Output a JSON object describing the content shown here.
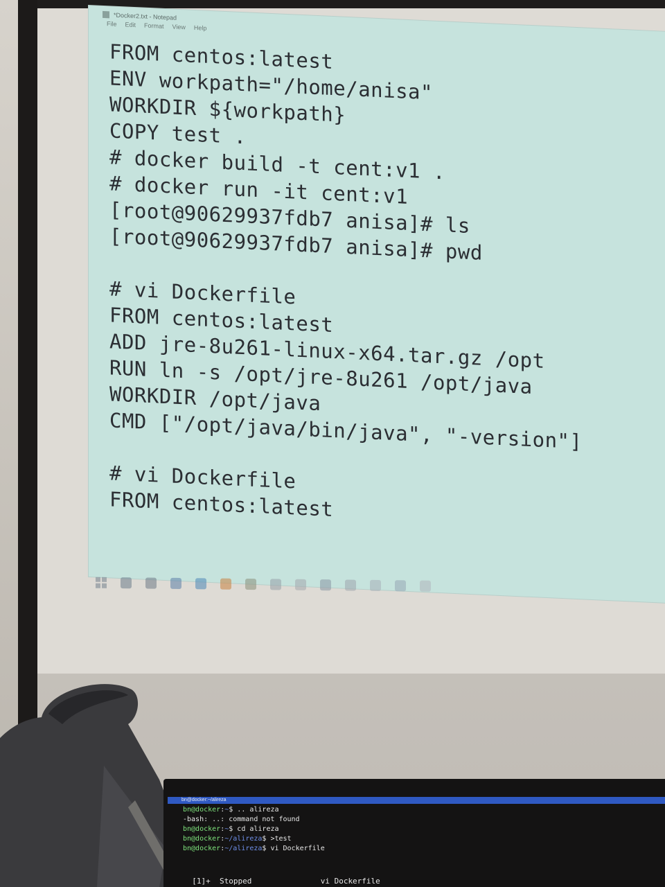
{
  "notepad": {
    "title": "*Docker2.txt - Notepad",
    "menu": [
      "File",
      "Edit",
      "Format",
      "View",
      "Help"
    ],
    "lines": [
      "FROM centos:latest",
      "ENV workpath=\"/home/anisa\"",
      "WORKDIR ${workpath}",
      "COPY test .",
      "# docker build -t cent:v1 .",
      "# docker run -it cent:v1",
      "[root@90629937fdb7 anisa]# ls",
      "[root@90629937fdb7 anisa]# pwd",
      "",
      "# vi Dockerfile",
      "FROM centos:latest",
      "ADD jre-8u261-linux-x64.tar.gz /opt",
      "RUN ln -s /opt/jre-8u261 /opt/java",
      "WORKDIR /opt/java",
      "CMD [\"/opt/java/bin/java\", \"-version\"]",
      "",
      "# vi Dockerfile",
      "FROM centos:latest"
    ]
  },
  "taskbar": {
    "icons": [
      "windows-start-icon",
      "search-icon",
      "task-view-icon",
      "edge-icon",
      "chrome-icon",
      "firefox-icon",
      "file-explorer-icon",
      "app-icon",
      "app-icon",
      "app-icon",
      "app-icon",
      "notepad-icon",
      "app-icon",
      "app-icon"
    ]
  },
  "terminal": {
    "title": "bn@docker:~/alireza",
    "lines": [
      {
        "user": "bn@docker",
        "path": "~",
        "prompt": "$",
        "cmd": " .. alireza"
      },
      {
        "plain": "-bash: ..: command not found"
      },
      {
        "user": "bn@docker",
        "path": "~",
        "prompt": "$",
        "cmd": " cd alireza"
      },
      {
        "user": "bn@docker",
        "path": "~/alireza",
        "prompt": "$",
        "cmd": " >test"
      },
      {
        "user": "bn@docker",
        "path": "~/alireza",
        "prompt": "$",
        "cmd": " vi Dockerfile"
      }
    ],
    "job": {
      "id": "[1]+",
      "status": "Stopped",
      "command": "vi Dockerfile"
    }
  }
}
